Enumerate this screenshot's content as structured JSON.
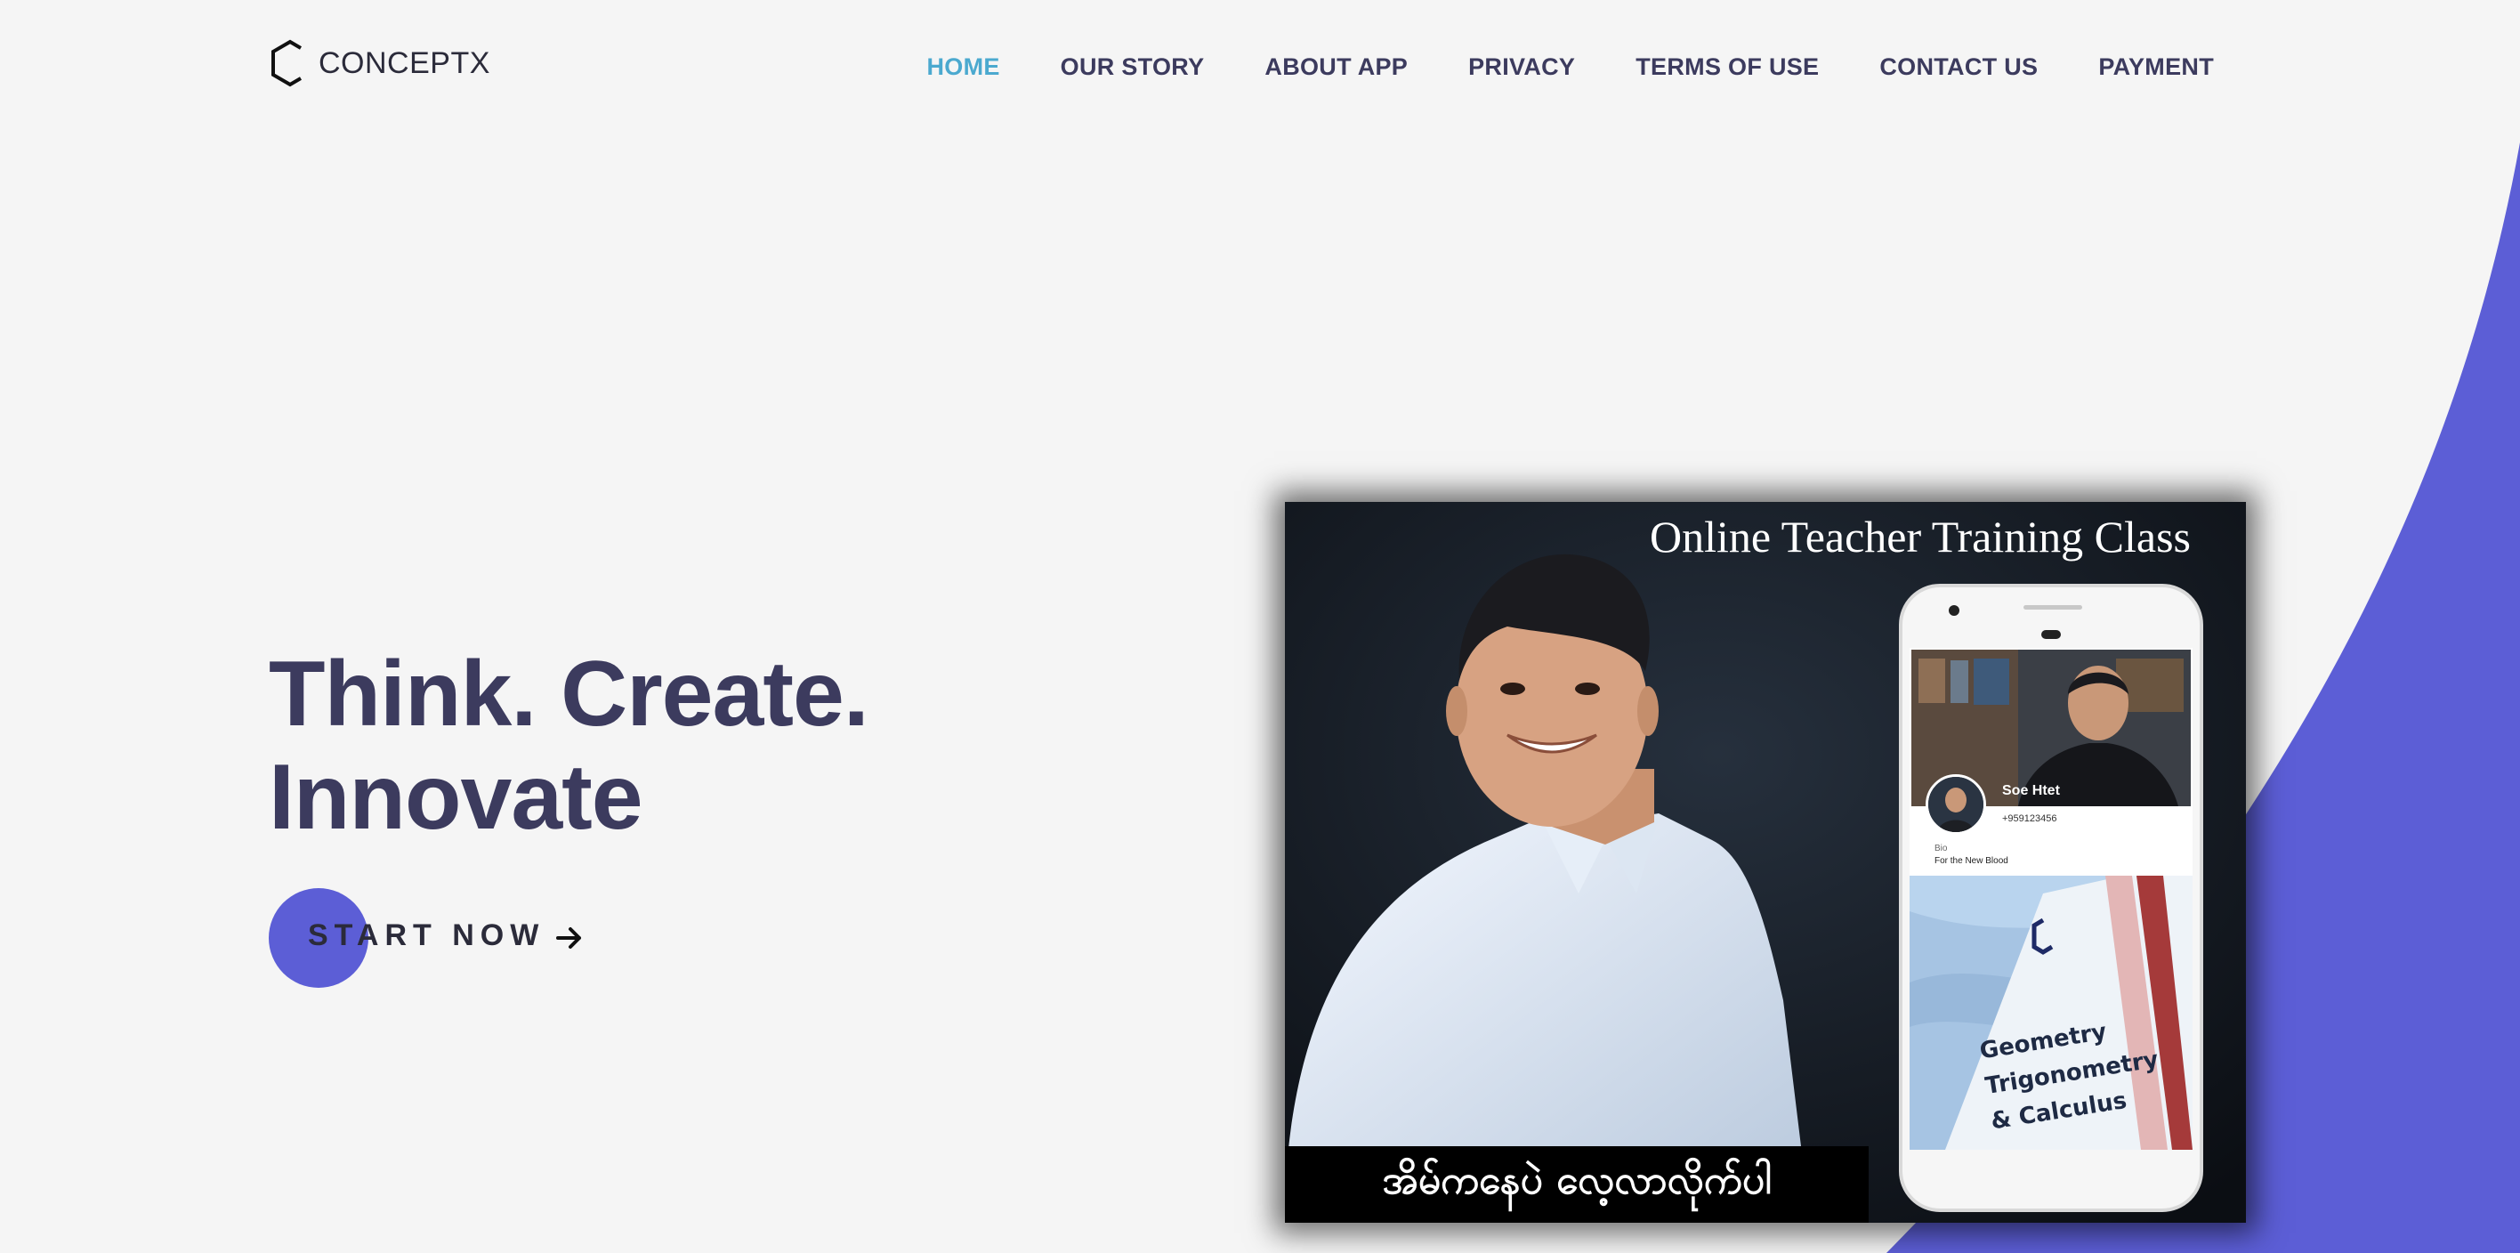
{
  "colors": {
    "accent": "#5c5ed6",
    "nav_active": "#4ba9cf",
    "heading": "#3c3b5e",
    "background": "#f5f5f5"
  },
  "brand": {
    "name": "CONCEPTX",
    "icon": "hexagon-logo-icon"
  },
  "nav": {
    "items": [
      {
        "label": "HOME",
        "active": true
      },
      {
        "label": "OUR STORY",
        "active": false
      },
      {
        "label": "ABOUT APP",
        "active": false
      },
      {
        "label": "PRIVACY",
        "active": false
      },
      {
        "label": "TERMS OF USE",
        "active": false
      },
      {
        "label": "CONTACT US",
        "active": false
      },
      {
        "label": "PAYMENT",
        "active": false
      }
    ]
  },
  "hero": {
    "title_line1": "Think. Create.",
    "title_line2": "Innovate",
    "cta_label": "START NOW",
    "cta_icon": "arrow-right-icon"
  },
  "promo": {
    "title": "Online Teacher Training Class",
    "caption": "အိမ်ကနေပဲ လေ့လာလိုက်ပါ",
    "phone": {
      "profile_name": "Soe Htet",
      "profile_phone": "+959123456",
      "bio_label": "Bio",
      "bio_text": "For the New Blood",
      "book_line1": "Geometry",
      "book_line2": "Trigonometry",
      "book_line3": "& Calculus"
    }
  }
}
